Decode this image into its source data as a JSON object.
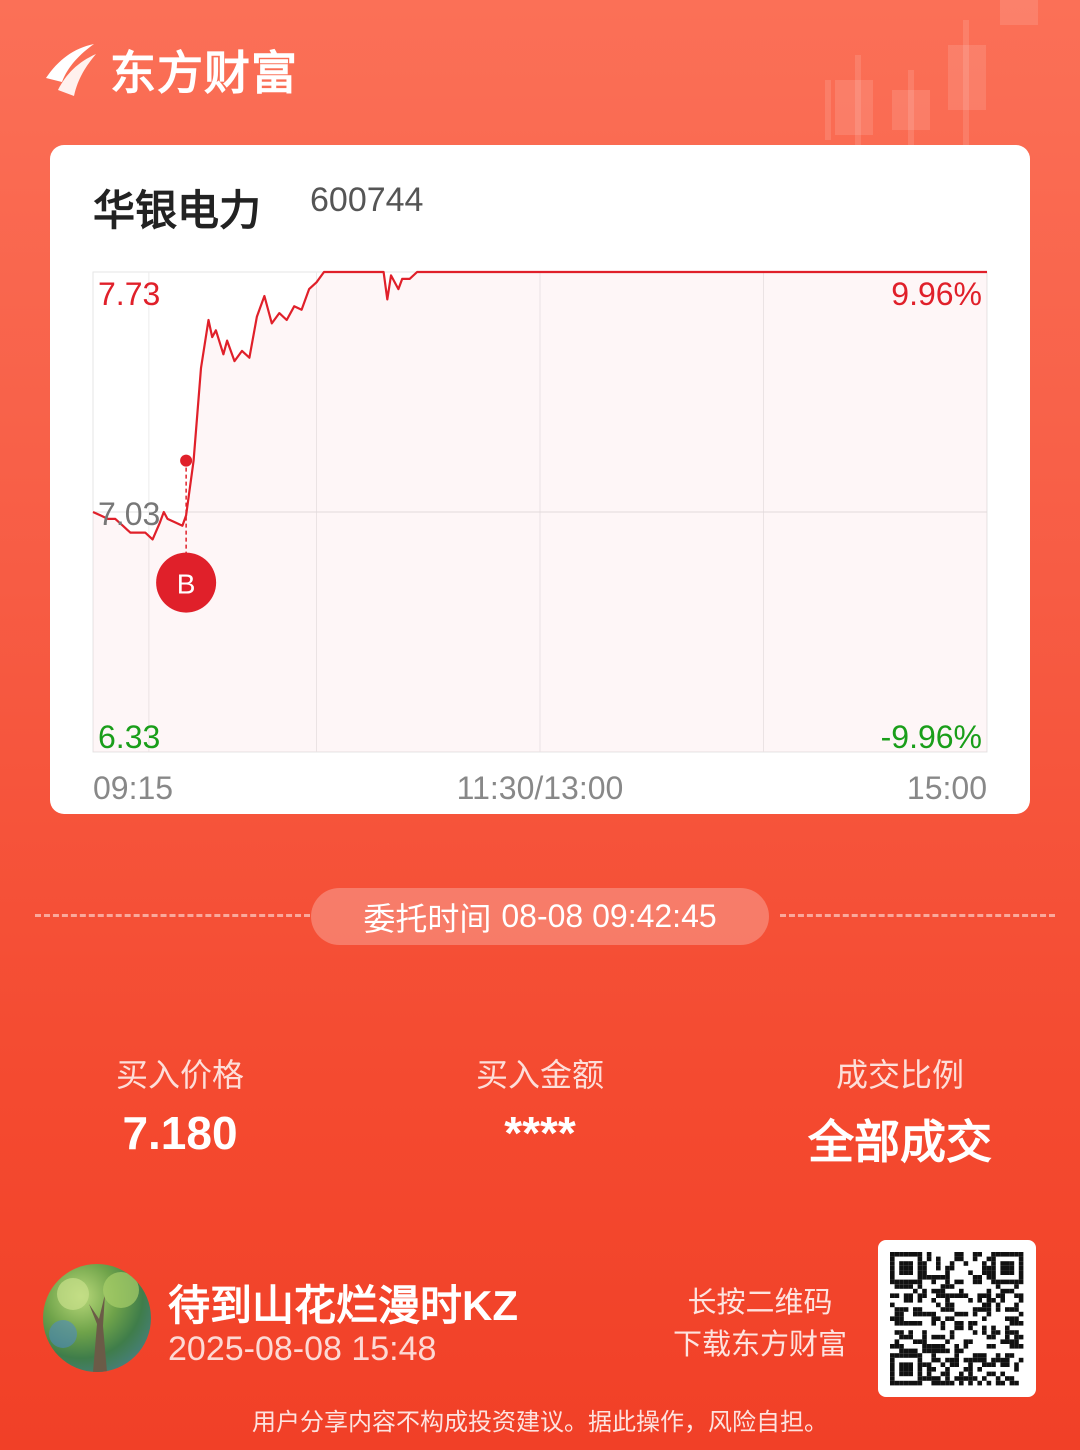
{
  "colors": {
    "up": "#e0202a",
    "down": "#1a9e1a",
    "neutral": "#777777",
    "brand": "#f5553c"
  },
  "brand": {
    "name": "东方财富"
  },
  "stock": {
    "name": "华银电力",
    "code": "600744"
  },
  "chart_data": {
    "type": "line",
    "y_axis_left": [
      "7.73",
      "7.03",
      "6.33"
    ],
    "y_axis_right": [
      "9.96%",
      "",
      "-9.96%"
    ],
    "x_labels": [
      "09:15",
      "11:30/13:00",
      "15:00"
    ],
    "ylim": [
      6.33,
      7.73
    ],
    "reference_price": 7.03,
    "series": [
      {
        "values": [
          [
            0,
            7.03
          ],
          [
            2,
            7.02
          ],
          [
            4,
            7.01
          ],
          [
            6,
            7.01
          ],
          [
            8,
            6.99
          ],
          [
            10,
            6.97
          ],
          [
            12,
            6.97
          ],
          [
            14,
            6.97
          ],
          [
            16,
            6.95
          ],
          [
            18,
            7.0
          ],
          [
            19,
            7.03
          ],
          [
            20,
            7.01
          ],
          [
            22,
            7.0
          ],
          [
            24,
            6.99
          ],
          [
            25,
            7.02
          ],
          [
            27,
            7.18
          ],
          [
            29,
            7.45
          ],
          [
            31,
            7.59
          ],
          [
            32,
            7.54
          ],
          [
            33,
            7.56
          ],
          [
            35,
            7.49
          ],
          [
            36,
            7.53
          ],
          [
            38,
            7.47
          ],
          [
            40,
            7.5
          ],
          [
            42,
            7.48
          ],
          [
            44,
            7.6
          ],
          [
            46,
            7.66
          ],
          [
            48,
            7.58
          ],
          [
            50,
            7.61
          ],
          [
            52,
            7.59
          ],
          [
            54,
            7.63
          ],
          [
            56,
            7.62
          ],
          [
            58,
            7.68
          ],
          [
            60,
            7.7
          ],
          [
            62,
            7.73
          ],
          [
            66,
            7.73
          ],
          [
            72,
            7.73
          ],
          [
            78,
            7.73
          ],
          [
            79,
            7.65
          ],
          [
            80,
            7.72
          ],
          [
            82,
            7.68
          ],
          [
            83,
            7.71
          ],
          [
            85,
            7.71
          ],
          [
            87,
            7.73
          ],
          [
            90,
            7.73
          ],
          [
            120,
            7.73
          ],
          [
            240,
            7.73
          ]
        ]
      }
    ],
    "trade_marker": {
      "label": "B",
      "minute": 25,
      "price": 7.18
    }
  },
  "order": {
    "time_label": "委托时间",
    "time_value": "08-08 09:42:45"
  },
  "stats": [
    {
      "label": "买入价格",
      "value": "7.180"
    },
    {
      "label": "买入金额",
      "value": "****"
    },
    {
      "label": "成交比例",
      "value": "全部成交"
    }
  ],
  "user": {
    "name": "待到山花烂漫时KZ",
    "datetime": "2025-08-08 15:48"
  },
  "qr_tip": {
    "line1": "长按二维码",
    "line2": "下载东方财富"
  },
  "disclaimer": "用户分享内容不构成投资建议。据此操作，风险自担。"
}
